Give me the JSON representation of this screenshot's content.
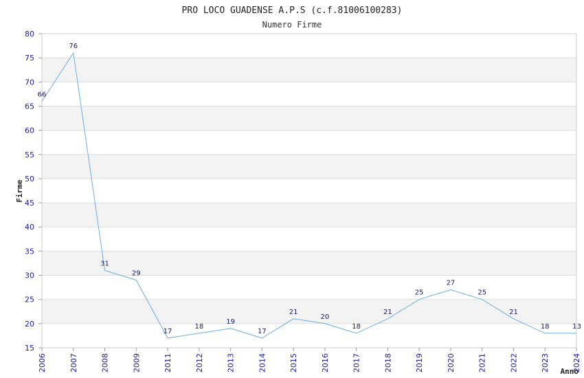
{
  "chart_data": {
    "type": "line",
    "title": "PRO LOCO GUADENSE A.P.S (c.f.81006100283)",
    "subtitle": "Numero Firme",
    "xlabel": "Anno",
    "ylabel": "Firme",
    "x": [
      "2006",
      "2007",
      "2008",
      "2009",
      "2011",
      "2012",
      "2013",
      "2014",
      "2015",
      "2016",
      "2017",
      "2018",
      "2019",
      "2020",
      "2021",
      "2022",
      "2023",
      "2024"
    ],
    "series": [
      {
        "values": [
          66,
          76,
          31,
          29,
          17,
          18,
          19,
          17,
          21,
          20,
          18,
          21,
          25,
          27,
          25,
          21,
          18,
          18
        ]
      }
    ],
    "data_labels": [
      "66",
      "76",
      "31",
      "29",
      "17",
      "18",
      "19",
      "17",
      "21",
      "20",
      "18",
      "21",
      "25",
      "27",
      "25",
      "21",
      "18",
      "13"
    ],
    "ylim": [
      15,
      80
    ],
    "yticks": [
      15,
      20,
      25,
      30,
      35,
      40,
      45,
      50,
      55,
      60,
      65,
      70,
      75,
      80
    ],
    "grid": true,
    "colors": {
      "line": "#6aaee8",
      "band_alt": "#f3f3f3",
      "gridline": "#dddddd",
      "tick_text": "#1a1aa6",
      "label_text": "#1a1a66"
    }
  }
}
